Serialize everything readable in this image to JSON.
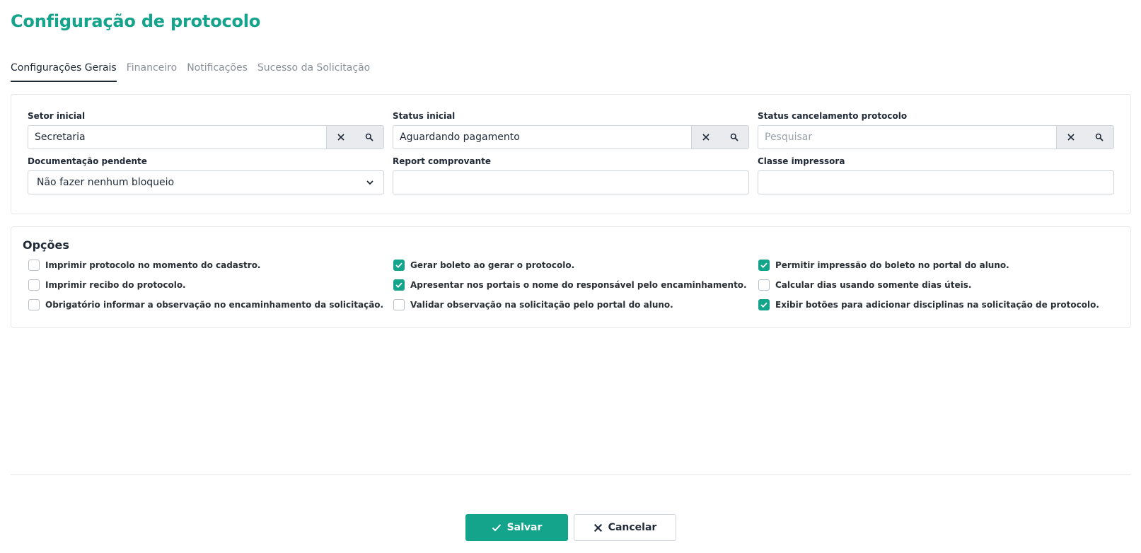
{
  "page": {
    "title": "Configuração de protocolo"
  },
  "tabs": [
    {
      "label": "Configurações Gerais",
      "active": true
    },
    {
      "label": "Financeiro",
      "active": false
    },
    {
      "label": "Notificações",
      "active": false
    },
    {
      "label": "Sucesso da Solicitação",
      "active": false
    }
  ],
  "fields": {
    "setor_inicial": {
      "label": "Setor inicial",
      "value": "Secretaria",
      "placeholder": ""
    },
    "status_inicial": {
      "label": "Status inicial",
      "value": "Aguardando pagamento",
      "placeholder": ""
    },
    "status_cancelamento": {
      "label": "Status cancelamento protocolo",
      "value": "",
      "placeholder": "Pesquisar"
    },
    "documentacao_pendente": {
      "label": "Documentação pendente",
      "value": "Não fazer nenhum bloqueio"
    },
    "report_comprovante": {
      "label": "Report comprovante",
      "value": ""
    },
    "classe_impressora": {
      "label": "Classe impressora",
      "value": ""
    }
  },
  "options": {
    "title": "Opções",
    "items": [
      {
        "label": "Imprimir protocolo no momento do cadastro.",
        "checked": false
      },
      {
        "label": "Gerar boleto ao gerar o protocolo.",
        "checked": true
      },
      {
        "label": "Permitir impressão do boleto no portal do aluno.",
        "checked": true
      },
      {
        "label": "Imprimir recibo do protocolo.",
        "checked": false
      },
      {
        "label": "Apresentar nos portais o nome do responsável pelo encaminhamento.",
        "checked": true
      },
      {
        "label": "Calcular dias usando somente dias úteis.",
        "checked": false
      },
      {
        "label": "Obrigatório informar a observação no encaminhamento da solicitação.",
        "checked": false
      },
      {
        "label": "Validar observação na solicitação pelo portal do aluno.",
        "checked": false
      },
      {
        "label": "Exibir botões para adicionar disciplinas na solicitação de protocolo.",
        "checked": true
      }
    ]
  },
  "footer": {
    "save_label": "Salvar",
    "cancel_label": "Cancelar"
  },
  "colors": {
    "accent": "#14a38b",
    "text": "#1f2937",
    "muted": "#8a8f98"
  },
  "icons": {
    "clear": "close-icon",
    "search": "search-icon",
    "dropdown": "chevron-down-icon",
    "check": "check-icon"
  }
}
